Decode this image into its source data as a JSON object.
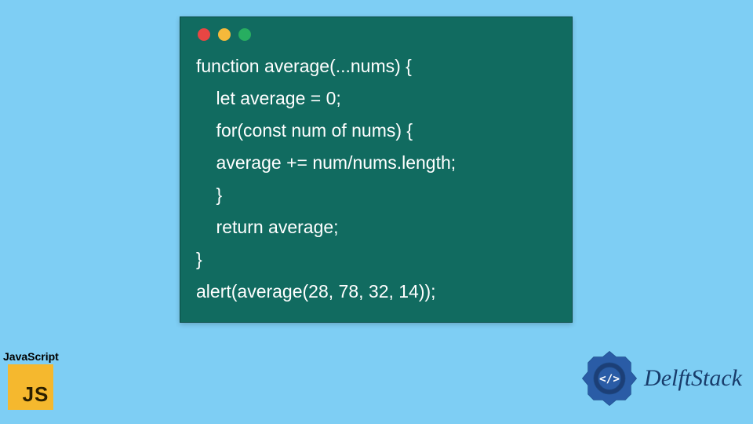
{
  "colors": {
    "page_bg": "#7ecef4",
    "card_bg": "#116b60",
    "dot_red": "#e84643",
    "dot_yellow": "#f6b93b",
    "dot_green": "#27ae60",
    "js_icon_bg": "#f5b82e",
    "delft_text": "#183c6b"
  },
  "code_lines": [
    "function average(...nums) {",
    "    let average = 0;",
    "    for(const num of nums) {",
    "    average += num/nums.length;",
    "    }",
    "    return average;",
    "}",
    "alert(average(28, 78, 32, 14));"
  ],
  "js_badge": {
    "label": "JavaScript",
    "icon_text": "JS"
  },
  "delft": {
    "text": "DelftStack",
    "logo_name": "delft-logo-icon"
  }
}
